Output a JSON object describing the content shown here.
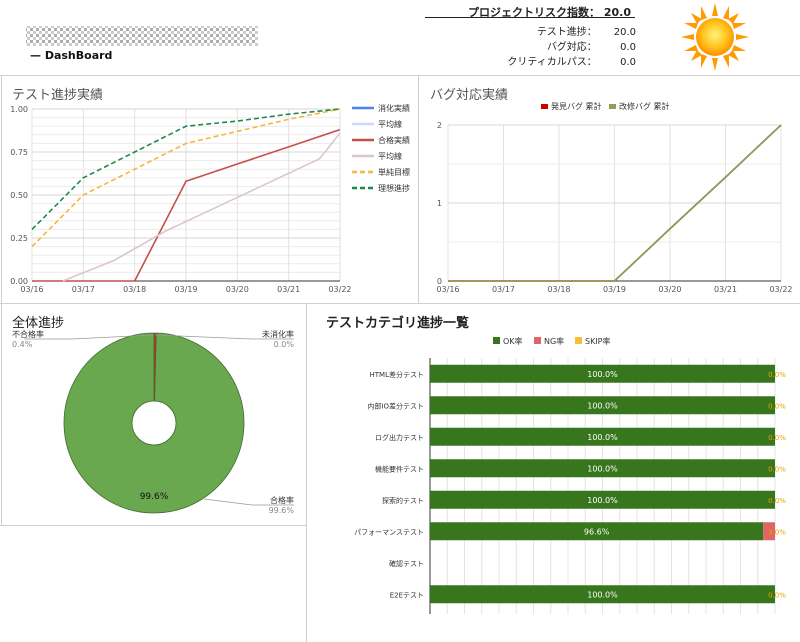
{
  "header": {
    "logo_text": "— DashBoard",
    "risk_label": "プロジェクトリスク指数：",
    "risk_value": "20.0",
    "metrics": [
      {
        "label": "テスト進捗：",
        "value": "20.0"
      },
      {
        "label": "バグ対応：",
        "value": "0.0"
      },
      {
        "label": "クリティカルパス：",
        "value": "0.0"
      }
    ],
    "weather_icon": "sun-icon",
    "colors": {
      "sun_outer": "#ff9a00",
      "sun_inner": "#ffe04a"
    }
  },
  "test_progress": {
    "title": "テスト進捗実績",
    "chart_data": {
      "type": "line",
      "x": [
        "03/16",
        "03/17",
        "03/18",
        "03/19",
        "03/20",
        "03/21",
        "03/22"
      ],
      "yticks": [
        "0.00",
        "0.25",
        "0.50",
        "0.75",
        "1.00"
      ],
      "ylim": [
        0,
        1
      ],
      "series": [
        {
          "name": "消化実績",
          "color": "#4a86e8",
          "dash": false,
          "values": [
            null,
            null,
            null,
            null,
            null,
            null,
            null
          ]
        },
        {
          "name": "平均線",
          "color": "#c9daf8",
          "dash": false,
          "values": [
            null,
            null,
            null,
            null,
            null,
            null,
            null
          ]
        },
        {
          "name": "合格実績",
          "color": "#c0504d",
          "dash": false,
          "values": [
            0,
            0,
            0,
            0.58,
            0.68,
            0.78,
            0.88
          ]
        },
        {
          "name": "平均線",
          "color": "#dcc6cc",
          "dash": false,
          "values": [
            null,
            0,
            0.12,
            0.29,
            0.43,
            0.57,
            0.71,
            0.86
          ]
        },
        {
          "name": "単純目標",
          "color": "#f6b73c",
          "dash": true,
          "values": [
            0.2,
            0.5,
            0.65,
            0.8,
            0.87,
            0.94,
            1.0
          ]
        },
        {
          "name": "理想進捗",
          "color": "#1e8a4c",
          "dash": true,
          "values": [
            0.3,
            0.6,
            0.75,
            0.9,
            0.93,
            0.97,
            1.0
          ]
        }
      ]
    }
  },
  "bug_progress": {
    "title": "バグ対応実績",
    "chart_data": {
      "type": "line",
      "x": [
        "03/16",
        "03/17",
        "03/18",
        "03/19",
        "03/20",
        "03/21",
        "03/22"
      ],
      "yticks": [
        "0",
        "1",
        "2"
      ],
      "ylim": [
        0,
        2
      ],
      "series": [
        {
          "name": "発見バグ 累計",
          "color": "#cc0000",
          "values": [
            0,
            0,
            0,
            0,
            0.67,
            1.33,
            2
          ]
        },
        {
          "name": "改修バグ 累計",
          "color": "#8aa05a",
          "values": [
            0,
            0,
            0,
            0,
            0.67,
            1.33,
            2
          ]
        }
      ]
    }
  },
  "overall_progress": {
    "title": "全体進捗",
    "chart_data": {
      "type": "pie",
      "slices": [
        {
          "name": "合格率",
          "value": 99.6,
          "pct": "99.6%",
          "color": "#6aa84f"
        },
        {
          "name": "不合格率",
          "value": 0.4,
          "pct": "0.4%",
          "color": "#a33a2a"
        },
        {
          "name": "未消化率",
          "value": 0.0,
          "pct": "0.0%",
          "color": "#4a86e8"
        }
      ],
      "center_label": "99.6%"
    }
  },
  "category_progress": {
    "title": "テストカテゴリ進捗一覧",
    "chart_data": {
      "type": "bar",
      "orientation": "horizontal",
      "stacked": true,
      "legend": [
        {
          "name": "OK率",
          "color": "#38761d"
        },
        {
          "name": "NG率",
          "color": "#e06666"
        },
        {
          "name": "SKIP率",
          "color": "#f1c232"
        }
      ],
      "categories": [
        "HTML差分テスト",
        "内部IO差分テスト",
        "ログ出力テスト",
        "機能要件テスト",
        "探索的テスト",
        "パフォーマンステスト",
        "確認テスト",
        "E2Eテスト"
      ],
      "series": [
        {
          "name": "OK率",
          "values": [
            100.0,
            100.0,
            100.0,
            100.0,
            100.0,
            96.6,
            0,
            100.0
          ],
          "labels": [
            "100.0%",
            "100.0%",
            "100.0%",
            "100.0%",
            "100.0%",
            "96.6%",
            "",
            "100.0%"
          ]
        },
        {
          "name": "NG率",
          "values": [
            0,
            0,
            0,
            0,
            0,
            3.4,
            0,
            0
          ],
          "labels": [
            "0.0%",
            "0.0%",
            "0.0%",
            "0.0%",
            "0.0%",
            "3.0%",
            "",
            "0.0%"
          ]
        },
        {
          "name": "SKIP率",
          "values": [
            0,
            0,
            0,
            0,
            0,
            0,
            0,
            0
          ]
        }
      ]
    }
  }
}
